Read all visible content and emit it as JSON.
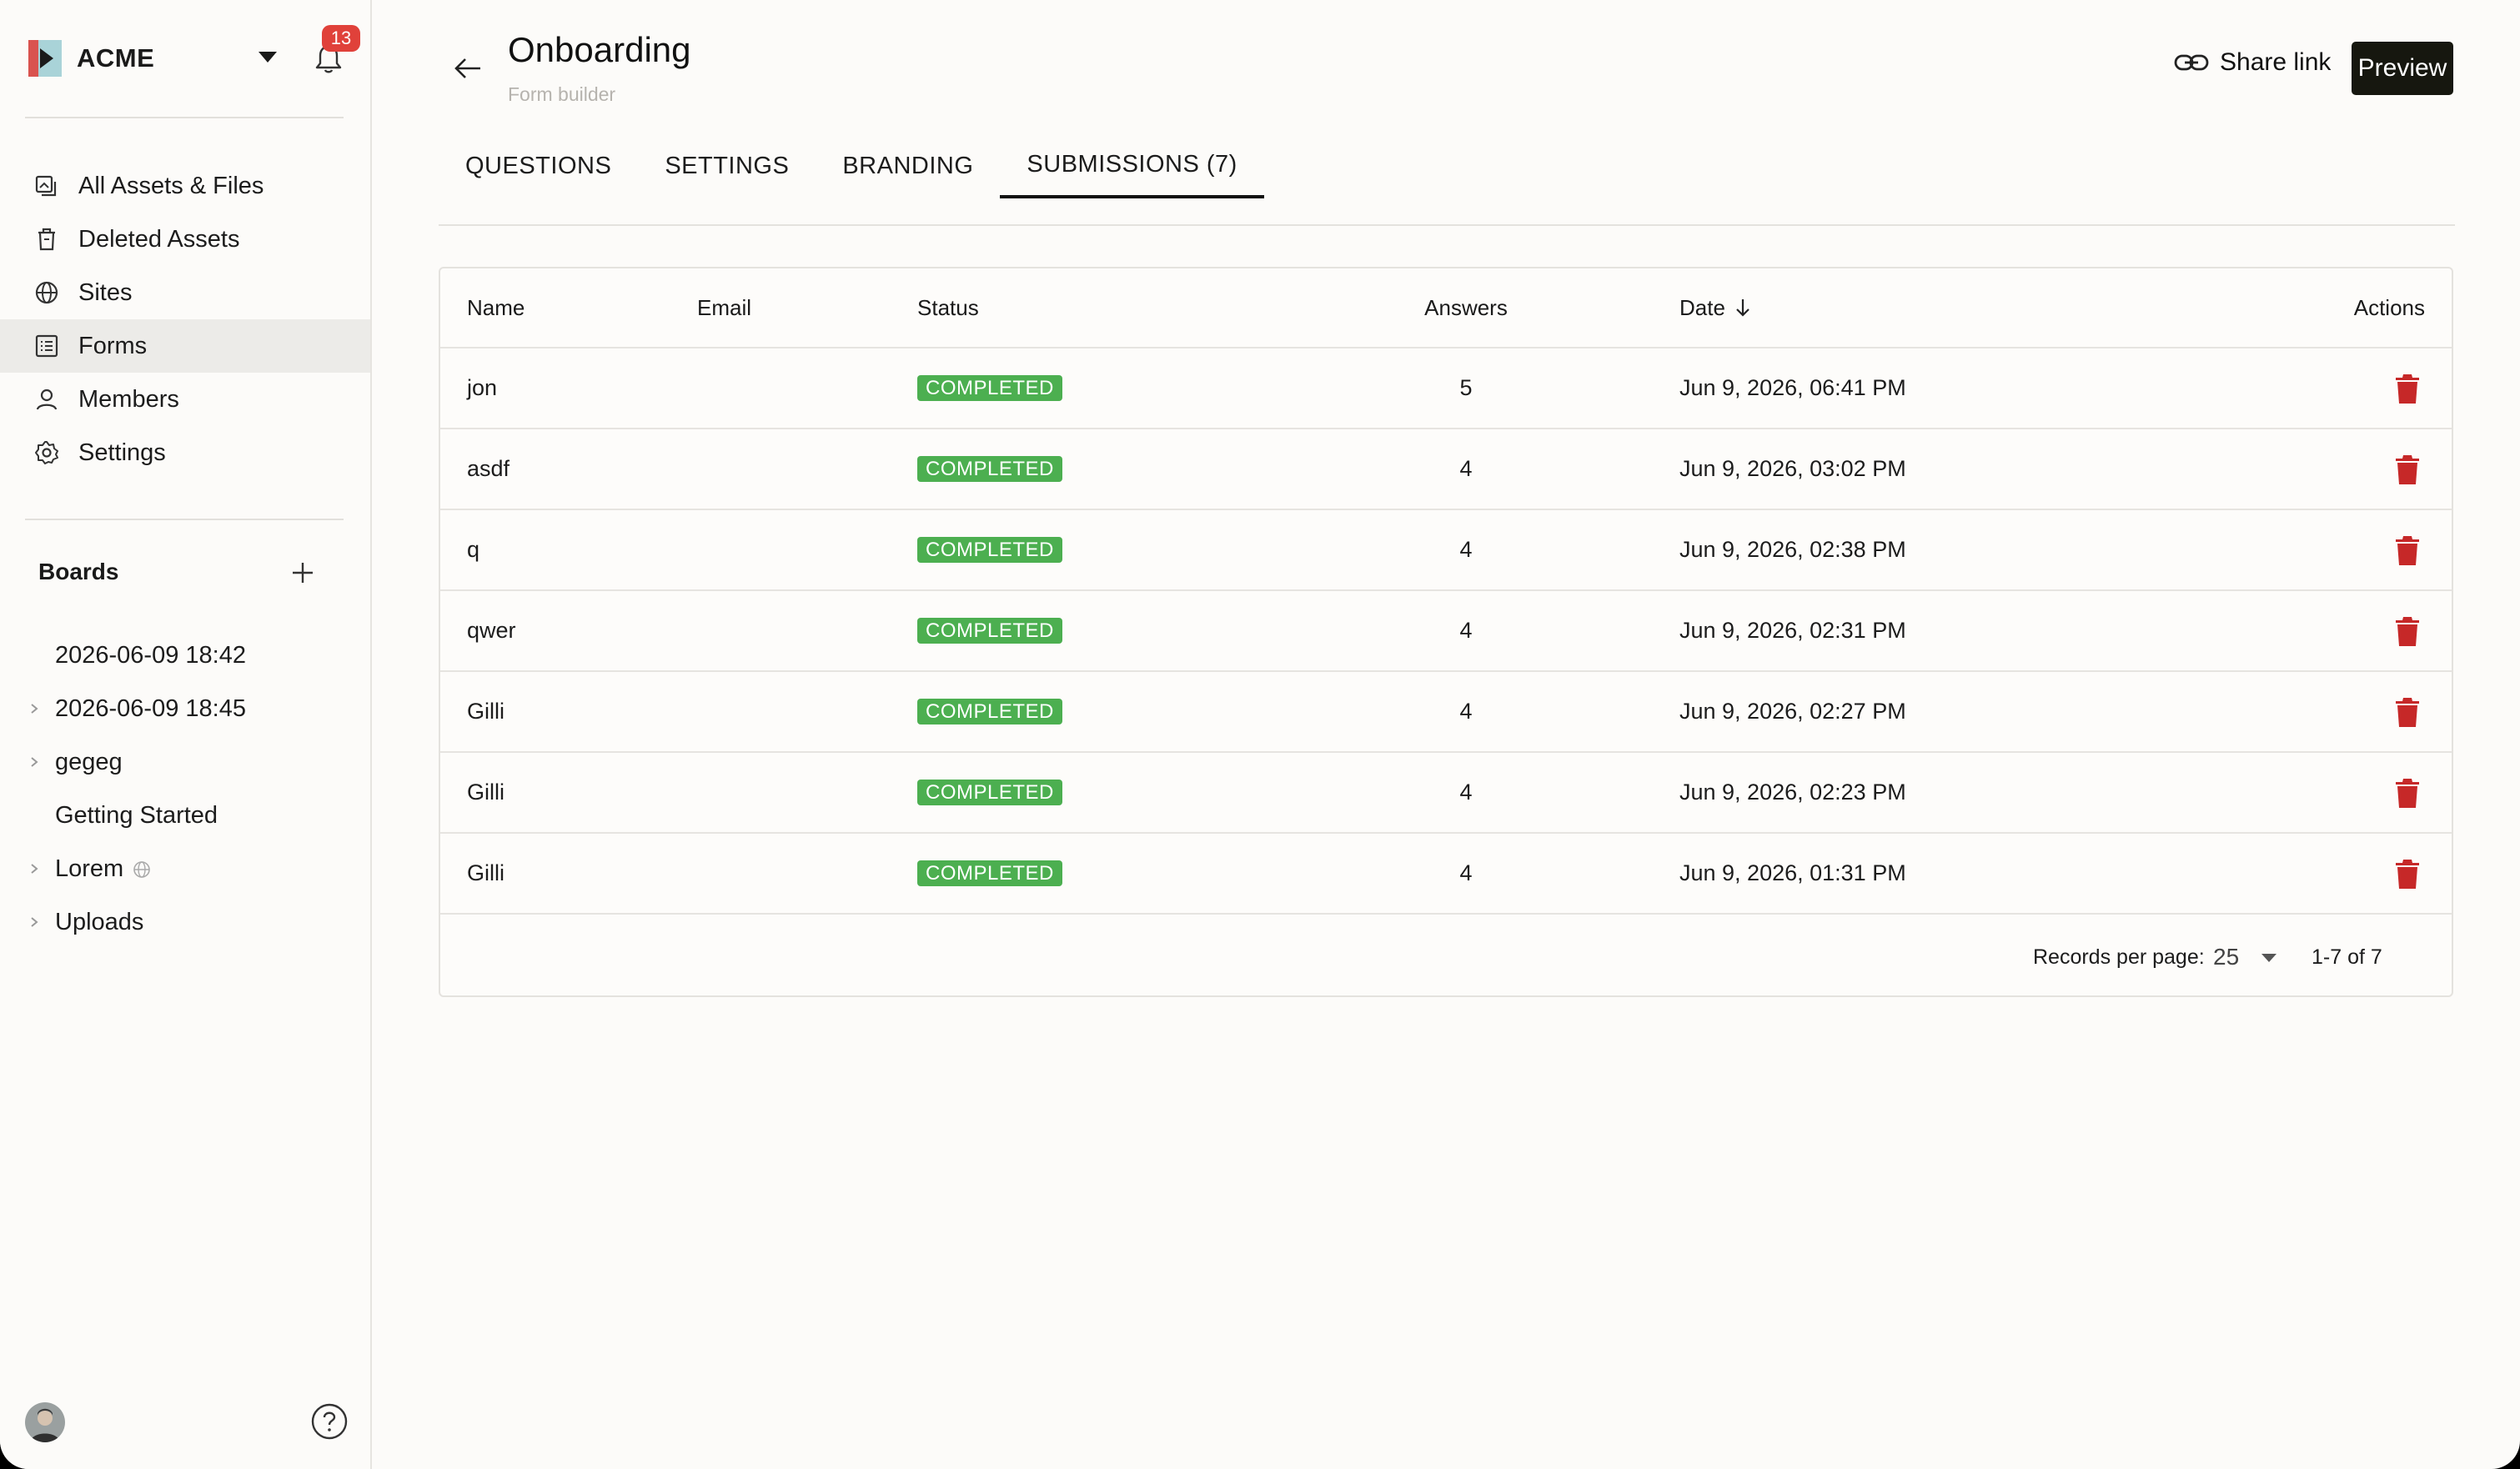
{
  "app": {
    "workspace": "ACME",
    "notifications_count": "13"
  },
  "sidebar": {
    "nav": [
      {
        "label": "All Assets & Files",
        "icon": "assets-icon"
      },
      {
        "label": "Deleted Assets",
        "icon": "trash-bin-icon"
      },
      {
        "label": "Sites",
        "icon": "globe-icon"
      },
      {
        "label": "Forms",
        "icon": "form-list-icon",
        "active": true
      },
      {
        "label": "Members",
        "icon": "user-icon"
      },
      {
        "label": "Settings",
        "icon": "gear-icon"
      }
    ],
    "boards_heading": "Boards",
    "boards": [
      {
        "label": "2026-06-09 18:42",
        "expandable": false
      },
      {
        "label": "2026-06-09 18:45",
        "expandable": true
      },
      {
        "label": "gegeg",
        "expandable": true
      },
      {
        "label": "Getting Started",
        "expandable": false
      },
      {
        "label": "Lorem",
        "expandable": true,
        "public": true
      },
      {
        "label": "Uploads",
        "expandable": true
      }
    ]
  },
  "header": {
    "title": "Onboarding",
    "subtitle": "Form builder",
    "share_label": "Share link",
    "preview_label": "Preview"
  },
  "tabs": [
    {
      "label": "QUESTIONS"
    },
    {
      "label": "SETTINGS"
    },
    {
      "label": "BRANDING"
    },
    {
      "label": "SUBMISSIONS (7)",
      "active": true
    }
  ],
  "table": {
    "columns": {
      "name": "Name",
      "email": "Email",
      "status": "Status",
      "answers": "Answers",
      "date": "Date",
      "actions": "Actions"
    },
    "rows": [
      {
        "name": "jon",
        "email": "",
        "status": "COMPLETED",
        "answers": "5",
        "date": "Jun 9, 2026, 06:41 PM"
      },
      {
        "name": "asdf",
        "email": "",
        "status": "COMPLETED",
        "answers": "4",
        "date": "Jun 9, 2026, 03:02 PM"
      },
      {
        "name": "q",
        "email": "",
        "status": "COMPLETED",
        "answers": "4",
        "date": "Jun 9, 2026, 02:38 PM"
      },
      {
        "name": "qwer",
        "email": "",
        "status": "COMPLETED",
        "answers": "4",
        "date": "Jun 9, 2026, 02:31 PM"
      },
      {
        "name": "Gilli",
        "email": "",
        "status": "COMPLETED",
        "answers": "4",
        "date": "Jun 9, 2026, 02:27 PM"
      },
      {
        "name": "Gilli",
        "email": "",
        "status": "COMPLETED",
        "answers": "4",
        "date": "Jun 9, 2026, 02:23 PM"
      },
      {
        "name": "Gilli",
        "email": "",
        "status": "COMPLETED",
        "answers": "4",
        "date": "Jun 9, 2026, 01:31 PM"
      }
    ],
    "footer": {
      "records_per_page_label": "Records per page:",
      "records_per_page": "25",
      "range": "1-7 of 7"
    }
  },
  "colors": {
    "status_completed": "#4caf50",
    "delete_icon": "#c62828",
    "badge": "#e0413a",
    "primary_button": "#16170f"
  }
}
